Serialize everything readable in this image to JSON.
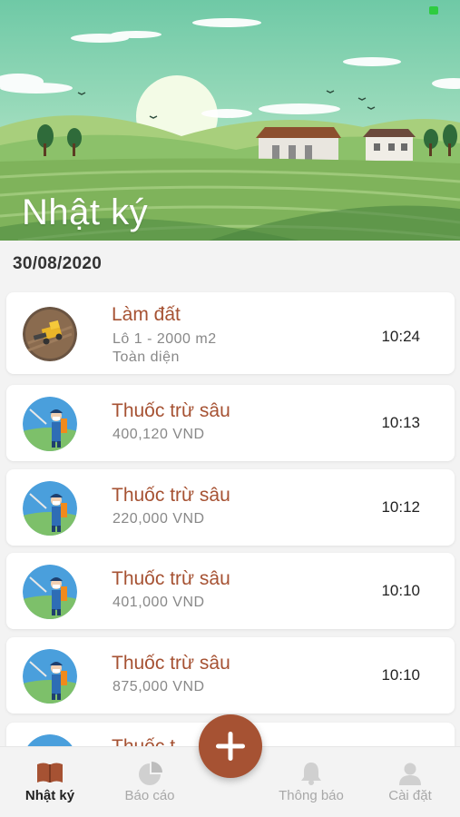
{
  "header": {
    "title": "Nhật ký"
  },
  "date": "30/08/2020",
  "entries": [
    {
      "icon": "harvester-icon",
      "title": "Làm đất",
      "line1": "Lô 1 - 2000 m2",
      "line2": "Toàn diện",
      "time": "10:24"
    },
    {
      "icon": "farmer-spraying-icon",
      "title": "Thuốc trừ sâu",
      "line1": "400,120 VND",
      "time": "10:13"
    },
    {
      "icon": "farmer-spraying-icon",
      "title": "Thuốc trừ sâu",
      "line1": "220,000 VND",
      "time": "10:12"
    },
    {
      "icon": "farmer-spraying-icon",
      "title": "Thuốc trừ sâu",
      "line1": "401,000 VND",
      "time": "10:10"
    },
    {
      "icon": "farmer-spraying-icon",
      "title": "Thuốc trừ sâu",
      "line1": "875,000 VND",
      "time": "10:10"
    },
    {
      "icon": "farmer-spraying-icon",
      "title": "Thuốc t",
      "line1": "",
      "time": ""
    }
  ],
  "tabbar": {
    "tabs": [
      {
        "label": "Nhật ký",
        "icon": "book-icon",
        "active": true
      },
      {
        "label": "Báo cáo",
        "icon": "pie-chart-icon",
        "active": false
      },
      {
        "label": "Thông báo",
        "icon": "bell-icon",
        "active": false
      },
      {
        "label": "Cài đặt",
        "icon": "user-icon",
        "active": false
      }
    ],
    "fab_icon": "plus-icon"
  },
  "colors": {
    "accent": "#a65233",
    "active_tab": "#222222",
    "inactive_tab": "#a8a8a8"
  }
}
